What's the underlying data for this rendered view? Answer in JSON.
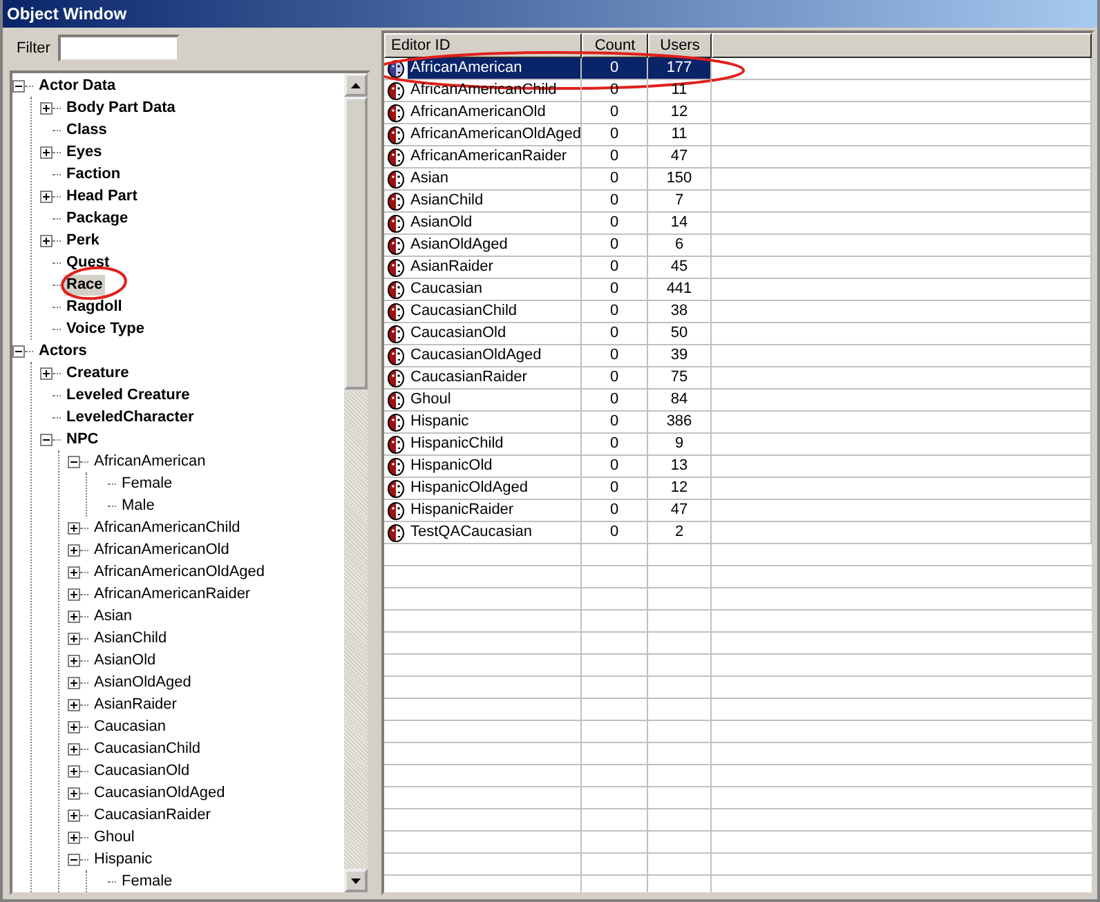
{
  "window": {
    "title": "Object Window"
  },
  "filter": {
    "label": "Filter"
  },
  "tree": [
    {
      "label": "Actor Data",
      "expanded": true,
      "selected": false,
      "children": [
        {
          "label": "Body Part Data",
          "expanded": false,
          "selected": false
        },
        {
          "label": "Class",
          "selected": false
        },
        {
          "label": "Eyes",
          "expanded": false,
          "selected": false
        },
        {
          "label": "Faction",
          "selected": false
        },
        {
          "label": "Head Part",
          "expanded": false,
          "selected": false
        },
        {
          "label": "Package",
          "selected": false
        },
        {
          "label": "Perk",
          "expanded": false,
          "selected": false
        },
        {
          "label": "Quest",
          "selected": false
        },
        {
          "label": "Race",
          "selected": true,
          "circled": true
        },
        {
          "label": "Ragdoll",
          "selected": false
        },
        {
          "label": "Voice Type",
          "selected": false
        }
      ]
    },
    {
      "label": "Actors",
      "expanded": true,
      "selected": false,
      "children": [
        {
          "label": "Creature",
          "expanded": false,
          "selected": false
        },
        {
          "label": "Leveled Creature",
          "selected": false
        },
        {
          "label": "LeveledCharacter",
          "selected": false
        },
        {
          "label": "NPC",
          "expanded": true,
          "selected": false,
          "children": [
            {
              "label": "AfricanAmerican",
              "expanded": true,
              "selected": false,
              "children": [
                {
                  "label": "Female",
                  "selected": false
                },
                {
                  "label": "Male",
                  "selected": false
                }
              ]
            },
            {
              "label": "AfricanAmericanChild",
              "expanded": false,
              "selected": false
            },
            {
              "label": "AfricanAmericanOld",
              "expanded": false,
              "selected": false
            },
            {
              "label": "AfricanAmericanOldAged",
              "expanded": false,
              "selected": false
            },
            {
              "label": "AfricanAmericanRaider",
              "expanded": false,
              "selected": false
            },
            {
              "label": "Asian",
              "expanded": false,
              "selected": false
            },
            {
              "label": "AsianChild",
              "expanded": false,
              "selected": false
            },
            {
              "label": "AsianOld",
              "expanded": false,
              "selected": false
            },
            {
              "label": "AsianOldAged",
              "expanded": false,
              "selected": false
            },
            {
              "label": "AsianRaider",
              "expanded": false,
              "selected": false
            },
            {
              "label": "Caucasian",
              "expanded": false,
              "selected": false
            },
            {
              "label": "CaucasianChild",
              "expanded": false,
              "selected": false
            },
            {
              "label": "CaucasianOld",
              "expanded": false,
              "selected": false
            },
            {
              "label": "CaucasianOldAged",
              "expanded": false,
              "selected": false
            },
            {
              "label": "CaucasianRaider",
              "expanded": false,
              "selected": false
            },
            {
              "label": "Ghoul",
              "expanded": false,
              "selected": false
            },
            {
              "label": "Hispanic",
              "expanded": true,
              "selected": false,
              "children": [
                {
                  "label": "Female",
                  "selected": false
                }
              ]
            }
          ]
        }
      ]
    }
  ],
  "table": {
    "columns": [
      "Editor ID",
      "Count",
      "Users"
    ],
    "rows": [
      {
        "editor_id": "AfricanAmerican",
        "count": "0",
        "users": "177",
        "selected": true,
        "circled": true
      },
      {
        "editor_id": "AfricanAmericanChild",
        "count": "0",
        "users": "11",
        "selected": false
      },
      {
        "editor_id": "AfricanAmericanOld",
        "count": "0",
        "users": "12",
        "selected": false
      },
      {
        "editor_id": "AfricanAmericanOldAged",
        "count": "0",
        "users": "11",
        "selected": false
      },
      {
        "editor_id": "AfricanAmericanRaider",
        "count": "0",
        "users": "47",
        "selected": false
      },
      {
        "editor_id": "Asian",
        "count": "0",
        "users": "150",
        "selected": false
      },
      {
        "editor_id": "AsianChild",
        "count": "0",
        "users": "7",
        "selected": false
      },
      {
        "editor_id": "AsianOld",
        "count": "0",
        "users": "14",
        "selected": false
      },
      {
        "editor_id": "AsianOldAged",
        "count": "0",
        "users": "6",
        "selected": false
      },
      {
        "editor_id": "AsianRaider",
        "count": "0",
        "users": "45",
        "selected": false
      },
      {
        "editor_id": "Caucasian",
        "count": "0",
        "users": "441",
        "selected": false
      },
      {
        "editor_id": "CaucasianChild",
        "count": "0",
        "users": "38",
        "selected": false
      },
      {
        "editor_id": "CaucasianOld",
        "count": "0",
        "users": "50",
        "selected": false
      },
      {
        "editor_id": "CaucasianOldAged",
        "count": "0",
        "users": "39",
        "selected": false
      },
      {
        "editor_id": "CaucasianRaider",
        "count": "0",
        "users": "75",
        "selected": false
      },
      {
        "editor_id": "Ghoul",
        "count": "0",
        "users": "84",
        "selected": false
      },
      {
        "editor_id": "Hispanic",
        "count": "0",
        "users": "386",
        "selected": false
      },
      {
        "editor_id": "HispanicChild",
        "count": "0",
        "users": "9",
        "selected": false
      },
      {
        "editor_id": "HispanicOld",
        "count": "0",
        "users": "13",
        "selected": false
      },
      {
        "editor_id": "HispanicOldAged",
        "count": "0",
        "users": "12",
        "selected": false
      },
      {
        "editor_id": "HispanicRaider",
        "count": "0",
        "users": "47",
        "selected": false
      },
      {
        "editor_id": "TestQACaucasian",
        "count": "0",
        "users": "2",
        "selected": false
      }
    ]
  }
}
